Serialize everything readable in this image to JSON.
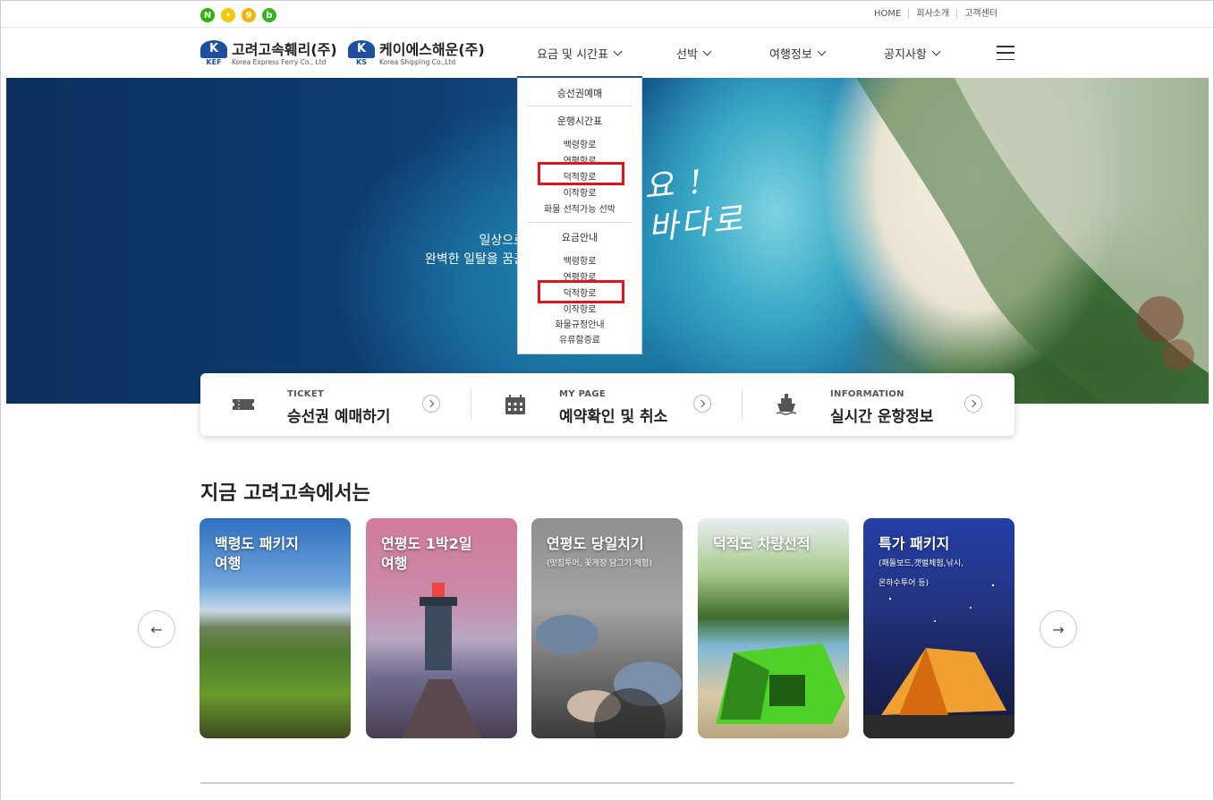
{
  "topbar": {
    "sns": [
      {
        "name": "naver",
        "glyph": "N",
        "color": "#2db400"
      },
      {
        "name": "kakao",
        "glyph": "•",
        "color": "#f6c800"
      },
      {
        "name": "kakaostory",
        "glyph": "9",
        "color": "#f2b705"
      },
      {
        "name": "blog",
        "glyph": "b",
        "color": "#3cb023"
      }
    ],
    "util_links": [
      "HOME",
      "회사소개",
      "고객센터"
    ]
  },
  "logos": [
    {
      "abbr": "KEF",
      "ko": "고려고속훼리(주)",
      "en": "Korea Express Ferry Co., Ltd"
    },
    {
      "abbr": "KS",
      "ko": "케이에스해운(주)",
      "en": "Korea Shipping Co.,Ltd"
    }
  ],
  "nav": [
    "요금 및 시간표",
    "선박",
    "여행정보",
    "공지사항"
  ],
  "hero": {
    "line1": "일상으로",
    "line2": "완벽한 일탈을 꿈꾼",
    "script1": "요 !",
    "script2": "바다로"
  },
  "dropdown": {
    "ticket": "승선권예매",
    "schedule_title": "운행시간표",
    "schedule_items": [
      "백령항로",
      "연평항로",
      "덕적항로",
      "이작항로",
      "화물 선적가능 선박"
    ],
    "fare_title": "요금안내",
    "fare_items": [
      "백령항로",
      "연평항로",
      "덕적항로",
      "이작항로",
      "화물규정안내",
      "유류할증료"
    ]
  },
  "quick": [
    {
      "small": "TICKET",
      "big": "승선권 예매하기",
      "icon": "ticket-icon"
    },
    {
      "small": "MY PAGE",
      "big": "예약확인 및 취소",
      "icon": "calendar-icon"
    },
    {
      "small": "INFORMATION",
      "big": "실시간 운항정보",
      "icon": "ship-icon"
    }
  ],
  "section_title": "지금 고려고속에서는",
  "cards": [
    {
      "title": "백령도 패키지\n여행",
      "sub": ""
    },
    {
      "title": "연평도 1박2일\n여행",
      "sub": ""
    },
    {
      "title": "연평도 당일치기",
      "sub": "(맛집투어, 꽃게장 담그기 체험)"
    },
    {
      "title": "덕적도 차량선적",
      "sub": ""
    },
    {
      "title": "특가 패키지",
      "sub": "(패들보드,갯벌체험,낚시,\n온하수투어 등)"
    }
  ],
  "carousel": {
    "prev": "←",
    "next": "→"
  }
}
